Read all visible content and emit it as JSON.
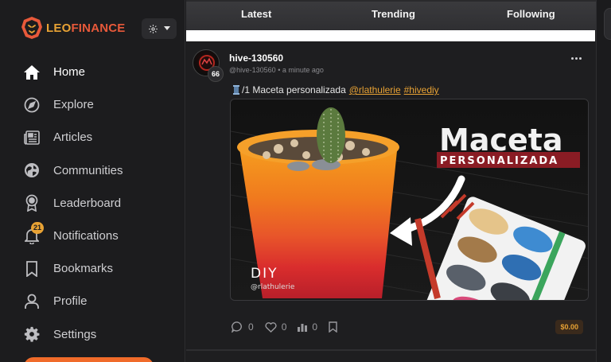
{
  "brand": {
    "name_part1": "LEO",
    "name_part2": "FINANCE",
    "color_primary": "#e8a234",
    "color_secondary": "#e8593a"
  },
  "sidebar": {
    "settings_icon": "gear-icon",
    "items": [
      {
        "label": "Home",
        "icon": "home-icon",
        "active": true
      },
      {
        "label": "Explore",
        "icon": "compass-icon"
      },
      {
        "label": "Articles",
        "icon": "newspaper-icon"
      },
      {
        "label": "Communities",
        "icon": "globe-icon"
      },
      {
        "label": "Leaderboard",
        "icon": "award-icon"
      },
      {
        "label": "Notifications",
        "icon": "bell-icon",
        "badge": "21"
      },
      {
        "label": "Bookmarks",
        "icon": "bookmark-icon"
      },
      {
        "label": "Profile",
        "icon": "user-icon"
      },
      {
        "label": "Settings",
        "icon": "gear-icon"
      }
    ]
  },
  "tabs": [
    {
      "label": "Latest"
    },
    {
      "label": "Trending"
    },
    {
      "label": "Following"
    }
  ],
  "post": {
    "author": "hive-130560",
    "handle": "@hive-130560",
    "time": "a minute ago",
    "reputation": "66",
    "text": "/1 Maceta personalizada",
    "mention": "@rlathulerie",
    "hashtag": "#hivediy",
    "image": {
      "title": "Maceta",
      "subtitle": "PERSONALIZADA",
      "tag": "DIY",
      "credit": "@rlathulerie"
    },
    "stats": {
      "comments": "0",
      "likes": "0",
      "reblogs": "0"
    },
    "payout": "$0.00"
  }
}
